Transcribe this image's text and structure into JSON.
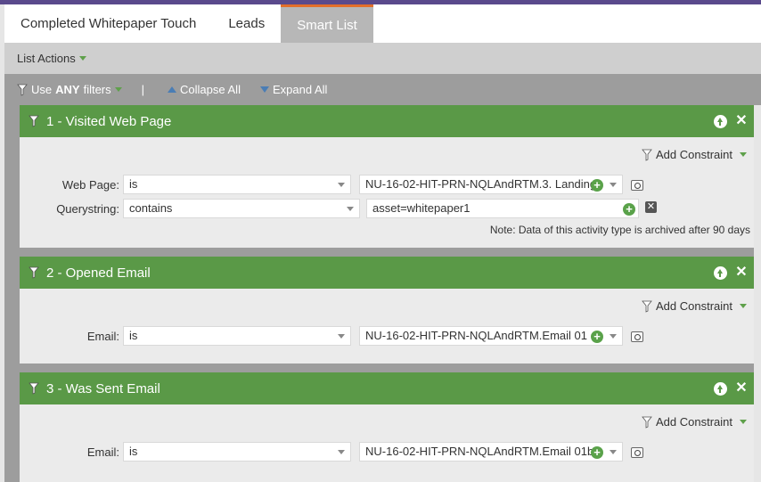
{
  "tabs": [
    {
      "label": "Completed Whitepaper Touch"
    },
    {
      "label": "Leads"
    },
    {
      "label": "Smart List"
    }
  ],
  "list_actions": {
    "label": "List Actions"
  },
  "filter_bar": {
    "use_prefix": "Use",
    "use_bold": "ANY",
    "use_suffix": "filters",
    "separator": "|",
    "collapse_all": "Collapse All",
    "expand_all": "Expand All"
  },
  "filters": [
    {
      "title": "1 - Visited Web Page",
      "add_constraint": "Add Constraint",
      "rows": [
        {
          "label": "Web Page:",
          "operator": "is",
          "value": "NU-16-02-HIT-PRN-NQLAndRTM.3. Landing"
        },
        {
          "label": "Querystring:",
          "operator": "contains",
          "value": "asset=whitepaper1"
        }
      ],
      "note": "Note: Data of this activity type is archived after 90 days"
    },
    {
      "title": "2 - Opened Email",
      "add_constraint": "Add Constraint",
      "rows": [
        {
          "label": "Email:",
          "operator": "is",
          "value": "NU-16-02-HIT-PRN-NQLAndRTM.Email 01"
        }
      ]
    },
    {
      "title": "3 - Was Sent Email",
      "add_constraint": "Add Constraint",
      "rows": [
        {
          "label": "Email:",
          "operator": "is",
          "value": "NU-16-02-HIT-PRN-NQLAndRTM.Email 01b"
        }
      ]
    }
  ],
  "colors": {
    "header_green": "#5a9947",
    "tab_accent": "#e36f2a",
    "top_strip": "#5a4a8c"
  }
}
